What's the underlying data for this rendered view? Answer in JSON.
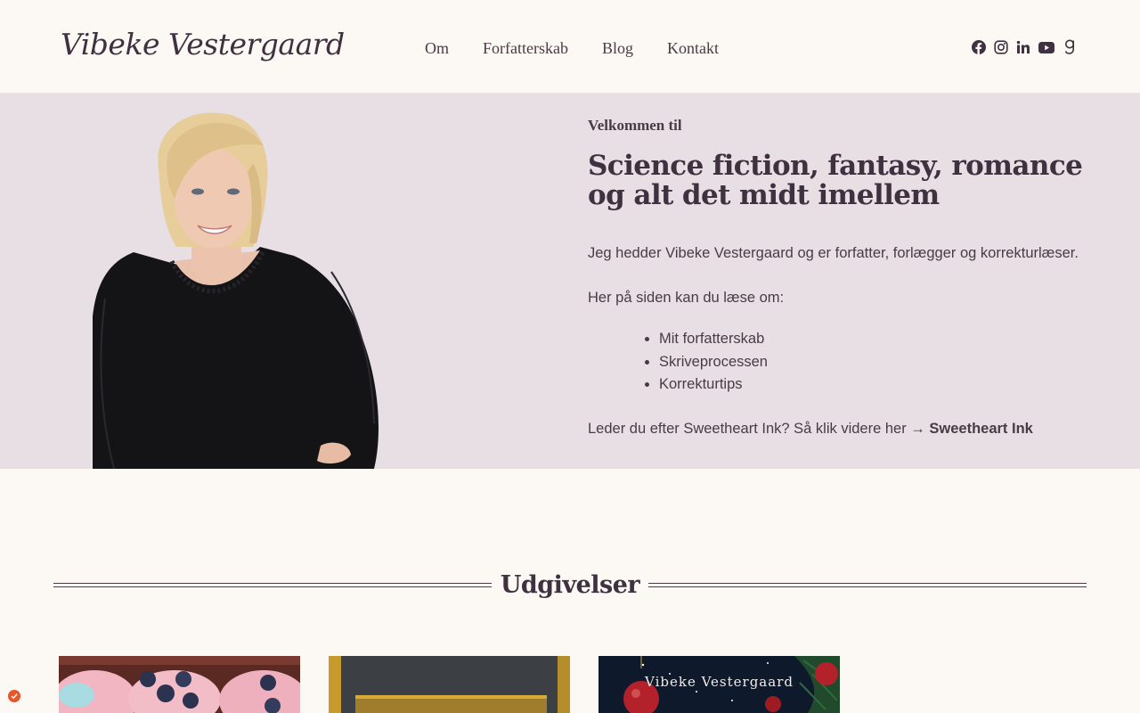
{
  "header": {
    "logo": "Vibeke Vestergaard",
    "nav": [
      "Om",
      "Forfatterskab",
      "Blog",
      "Kontakt"
    ],
    "social_icons": [
      "facebook-icon",
      "instagram-icon",
      "linkedin-icon",
      "youtube-icon",
      "goodreads-icon"
    ]
  },
  "hero": {
    "kicker": "Velkommen til",
    "headline": "Science fiction, fantasy, romance og alt det midt imellem",
    "intro": "Jeg hedder Vibeke Vestergaard og er forfatter, forlægger og korrekturlæser.",
    "list_intro": "Her på siden kan du læse om:",
    "topics": [
      "Mit forfatterskab",
      "Skriveprocessen",
      "Korrekturtips"
    ],
    "cta_text": "Leder du efter Sweetheart Ink? Så klik videre her →",
    "cta_link": "Sweetheart Ink"
  },
  "releases": {
    "title": "Udgivelser",
    "book3_cover_author": "Vibeke Vestergaard"
  },
  "colors": {
    "background": "#fcf8f4",
    "hero_background": "#e8dfe5",
    "text": "#4a3a45",
    "consent_badge": "#e8562a"
  }
}
